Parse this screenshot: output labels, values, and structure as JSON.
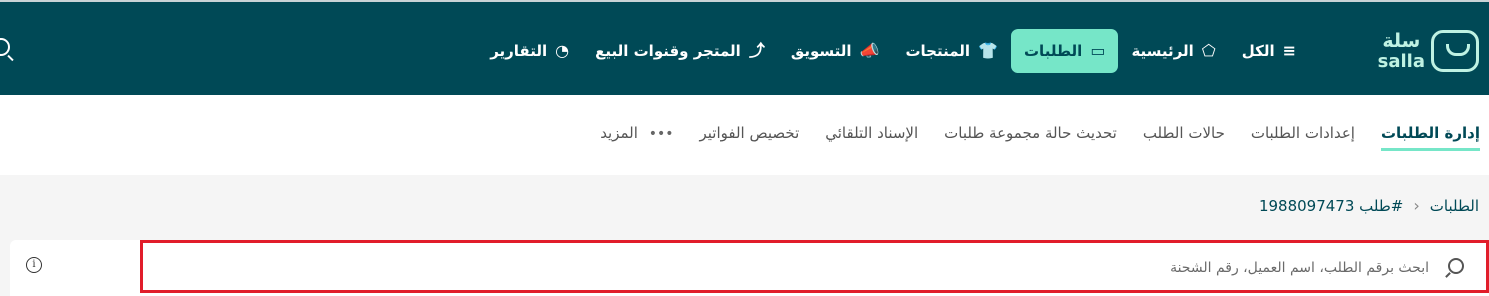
{
  "brand": {
    "name_ar": "سلة",
    "name_en": "salla"
  },
  "nav": {
    "items": [
      {
        "label": "الكل",
        "icon": "≡"
      },
      {
        "label": "الرئيسية",
        "icon": "⬠"
      },
      {
        "label": "الطلبات",
        "icon": "▭",
        "active": true
      },
      {
        "label": "المنتجات",
        "icon": "👕"
      },
      {
        "label": "التسويق",
        "icon": "📣"
      },
      {
        "label": "المتجر وقنوات البيع",
        "icon": "⤴"
      },
      {
        "label": "التقارير",
        "icon": "◔"
      }
    ]
  },
  "subnav": {
    "items": [
      {
        "label": "إدارة الطلبات",
        "active": true
      },
      {
        "label": "إعدادات الطلبات"
      },
      {
        "label": "حالات الطلب"
      },
      {
        "label": "تحديث حالة مجموعة طلبات"
      },
      {
        "label": "الإسناد التلقائي"
      },
      {
        "label": "تخصيص الفواتير"
      },
      {
        "label": "المزيد",
        "dots": "•••"
      }
    ]
  },
  "breadcrumb": {
    "root": "الطلبات",
    "separator": "›",
    "current": "طلب 1988097473#"
  },
  "search": {
    "placeholder": "ابحث برقم الطلب، اسم العميل، رقم الشحنة",
    "value": ""
  },
  "info": {
    "symbol": "i"
  },
  "colors": {
    "topbar": "#004956",
    "accent": "#76e6c8",
    "highlight": "#e11d2a"
  }
}
